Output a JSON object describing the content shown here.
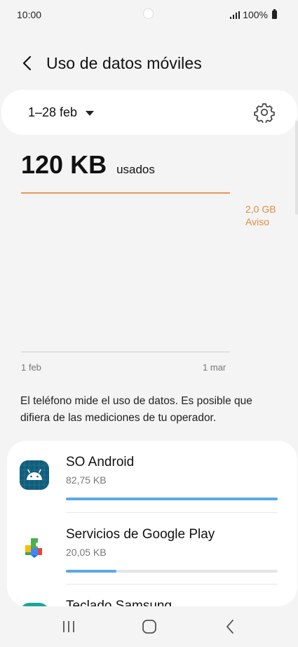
{
  "status_bar": {
    "time": "10:00",
    "battery_text": "100%"
  },
  "header": {
    "title": "Uso de datos móviles",
    "back_icon": "chevron-left-icon"
  },
  "period": {
    "label": "1–28 feb",
    "settings_icon": "gear-icon"
  },
  "usage": {
    "amount": "120 KB",
    "label": "usados"
  },
  "chart": {
    "warning_value": "2,0 GB",
    "warning_label": "Aviso",
    "x_start": "1 feb",
    "x_end": "1 mar",
    "warning_color": "#e08a44"
  },
  "info": {
    "text": "El teléfono mide el uso de datos. Es posible que difiera de las mediciones de tu operador."
  },
  "apps": [
    {
      "name": "SO Android",
      "size": "82,75 KB",
      "usage_fraction": 1.0,
      "icon": "android-icon"
    },
    {
      "name": "Servicios de Google Play",
      "size": "20,05 KB",
      "usage_fraction": 0.24,
      "icon": "google-play-services-icon"
    },
    {
      "name": "Teclado Samsung",
      "icon": "samsung-keyboard-icon"
    }
  ],
  "nav": {
    "recents_icon": "recents-icon",
    "home_icon": "home-icon",
    "back_icon": "back-icon"
  },
  "colors": {
    "accent_bar": "#5aa9e6",
    "background": "#f4f4f4"
  }
}
